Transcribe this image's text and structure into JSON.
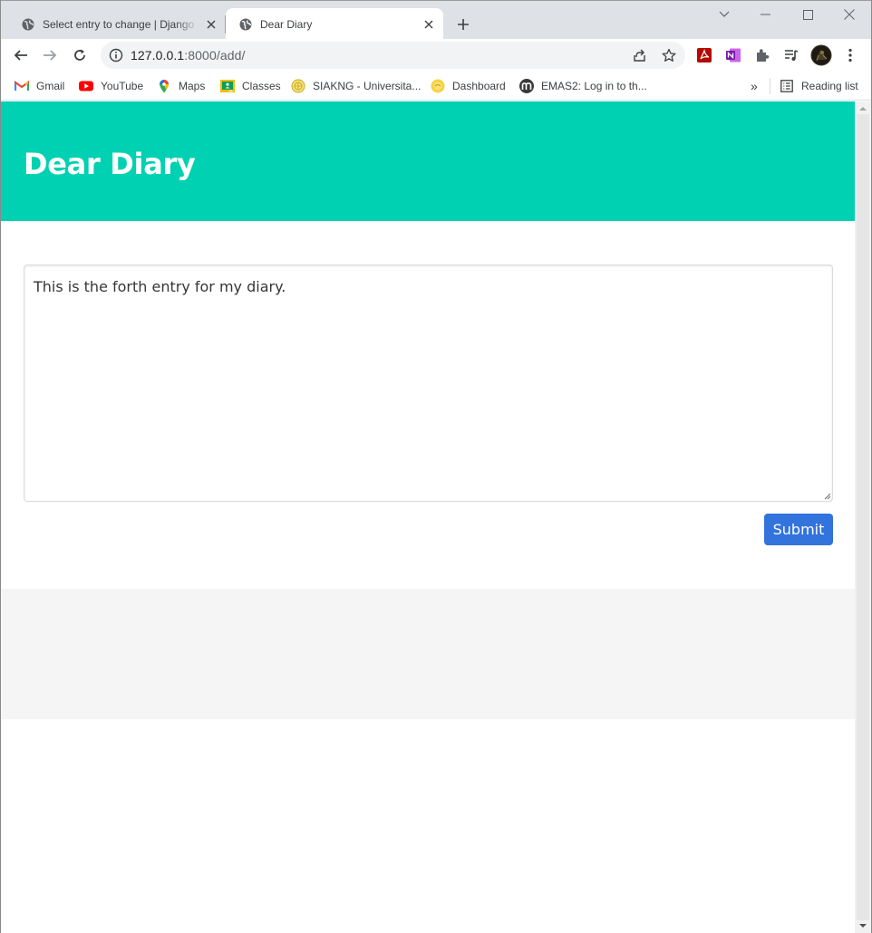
{
  "browser": {
    "tabs": [
      {
        "title": "Select entry to change | Django site admin",
        "active": false
      },
      {
        "title": "Dear Diary",
        "active": true
      }
    ],
    "address": {
      "host": "127.0.0.1",
      "path": ":8000/add/"
    },
    "bookmarks": [
      {
        "label": "Gmail",
        "icon": "gmail-icon"
      },
      {
        "label": "YouTube",
        "icon": "youtube-icon"
      },
      {
        "label": "Maps",
        "icon": "maps-icon"
      },
      {
        "label": "Classes",
        "icon": "classroom-icon"
      },
      {
        "label": "SIAKNG - Universita...",
        "icon": "siakng-icon"
      },
      {
        "label": "Dashboard",
        "icon": "dashboard-icon"
      },
      {
        "label": "EMAS2: Log in to th...",
        "icon": "moodle-icon"
      }
    ],
    "reading_list_label": "Reading list",
    "overflow_label": "»"
  },
  "page": {
    "title": "Dear Diary",
    "entry_text": "This is the forth entry for my diary.",
    "submit_label": "Submit"
  },
  "colors": {
    "hero": "#00d1b2",
    "button": "#3273dc",
    "footer": "#f5f5f5"
  }
}
